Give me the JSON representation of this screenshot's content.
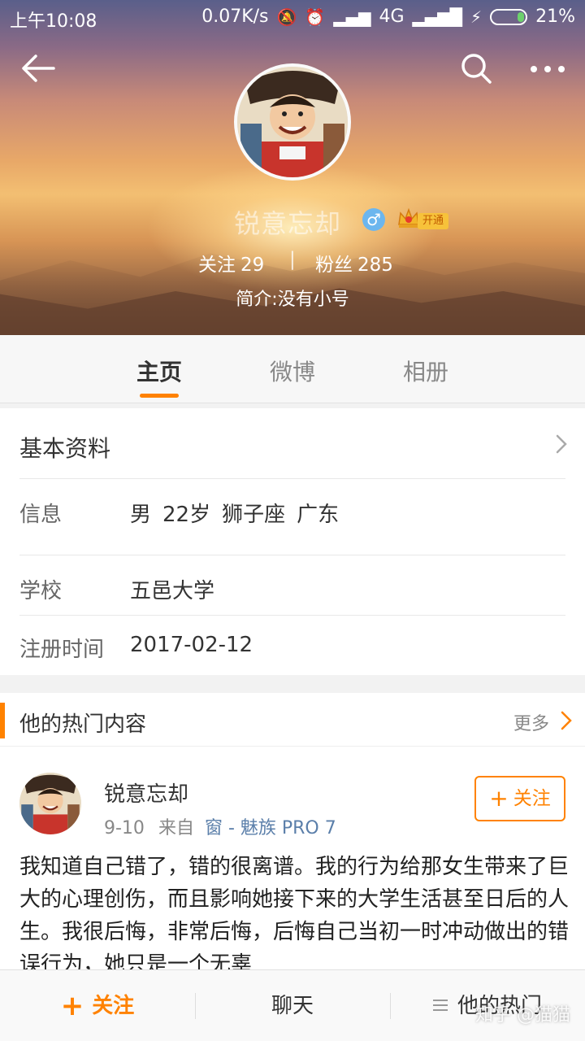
{
  "status_bar": {
    "time": "上午10:08",
    "speed": "0.07K/s",
    "network": "4G",
    "battery": "21%",
    "battery_level": 0.21
  },
  "header": {
    "icons": [
      "back-icon",
      "search-icon",
      "more-icon"
    ],
    "username": "锐意忘却",
    "gender": "♂",
    "vip_label": "开通",
    "following_label": "关注",
    "following_count": "29",
    "separator": "|",
    "fans_label": "粉丝",
    "fans_count": "285",
    "bio": "简介:没有小号"
  },
  "tabs": [
    {
      "label": "主页",
      "active": true
    },
    {
      "label": "微博",
      "active": false
    },
    {
      "label": "相册",
      "active": false
    }
  ],
  "basic_info": {
    "title": "基本资料",
    "rows": [
      {
        "label": "信息",
        "values": [
          "男",
          "22岁",
          "狮子座",
          "广东"
        ]
      },
      {
        "label": "学校",
        "value": "五邑大学"
      },
      {
        "label": "注册时间",
        "value": "2017-02-12"
      }
    ]
  },
  "hot": {
    "title": "他的热门内容",
    "more": "更多"
  },
  "post": {
    "author": "锐意忘却",
    "date": "9-10",
    "from_label": "来自",
    "source": "窗 - 魅族 PRO 7",
    "follow_label": "关注",
    "text": "我知道自己错了，错的很离谱。我的行为给那女生带来了巨大的心理创伤，而且影响她接下来的大学生活甚至日后的人生。我很后悔，非常后悔，后悔自己当初一时冲动做出的错误行为，她只是一个无辜"
  },
  "bottom_bar": {
    "follow": "关注",
    "chat": "聊天",
    "hot": "他的热门"
  },
  "watermark": "知乎 @猫猫",
  "colors": {
    "accent": "#ff8200",
    "link": "#5b7faa",
    "gender": "#6cb6ee"
  }
}
